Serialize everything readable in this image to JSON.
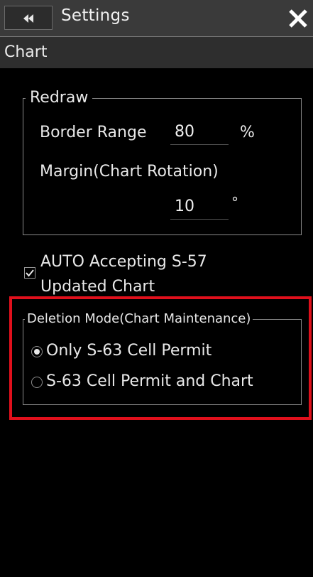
{
  "window": {
    "title": "Settings",
    "back_icon": "double-chevron-left-icon",
    "close_icon": "close-icon"
  },
  "section": {
    "title": "Chart"
  },
  "redraw": {
    "legend": "Redraw",
    "border_range_label": "Border Range",
    "border_range_value": "80",
    "border_range_unit": "%",
    "margin_label": "Margin(Chart Rotation)",
    "margin_value": "10",
    "margin_unit": "°"
  },
  "auto_accept": {
    "label_line1": "AUTO Accepting S-57",
    "label_line2": "Updated Chart",
    "checked": true
  },
  "deletion_mode": {
    "legend": "Deletion Mode(Chart Maintenance)",
    "options": [
      {
        "label": "Only S-63 Cell Permit",
        "selected": true
      },
      {
        "label": "S-63 Cell Permit and Chart",
        "selected": false
      }
    ]
  },
  "colors": {
    "highlight": "#e0101c",
    "background": "#000000",
    "titlebar": "#3a3a3a"
  }
}
